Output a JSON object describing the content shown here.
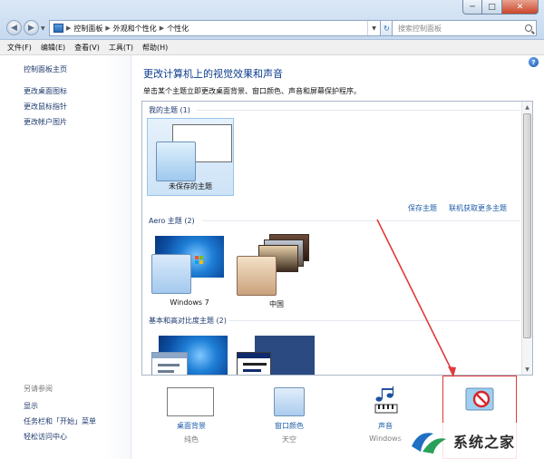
{
  "window": {
    "controls": {
      "minimize": "─",
      "maximize": "□",
      "close": "✕"
    }
  },
  "nav": {
    "back": "◀",
    "forward": "▶",
    "dropdown": "▼"
  },
  "address": {
    "crumbs": [
      "控制面板",
      "外观和个性化",
      "个性化"
    ],
    "separator": "▶",
    "dropdown": "▼"
  },
  "refresh": "↻",
  "search": {
    "placeholder": "搜索控制面板"
  },
  "menubar": [
    "文件(F)",
    "编辑(E)",
    "查看(V)",
    "工具(T)",
    "帮助(H)"
  ],
  "sidebar": {
    "home": "控制面板主页",
    "links": [
      "更改桌面图标",
      "更改鼠标指针",
      "更改帐户图片"
    ],
    "see_also": "另请参阅",
    "see_also_links": [
      "显示",
      "任务栏和「开始」菜单",
      "轻松访问中心"
    ]
  },
  "help": "?",
  "main": {
    "title": "更改计算机上的视觉效果和声音",
    "description": "单击某个主题立即更改桌面背景、窗口颜色、声音和屏幕保护程序。"
  },
  "themes": {
    "my_themes_header": "我的主题 (1)",
    "unsaved_theme": "未保存的主题",
    "save_theme": "保存主题",
    "get_more_online": "联机获取更多主题",
    "aero_header": "Aero 主题 (2)",
    "aero": [
      "Windows 7",
      "中国"
    ],
    "basic_header": "基本和高对比度主题 (2)"
  },
  "scrollbar": {
    "up": "▲",
    "down": "▼"
  },
  "customize": [
    {
      "label": "桌面背景",
      "value": "纯色"
    },
    {
      "label": "窗口颜色",
      "value": "天空"
    },
    {
      "label": "声音",
      "value": "Windows"
    }
  ],
  "watermark": {
    "text": "系统之家"
  },
  "colors": {
    "link": "#1e5ca8",
    "title": "#0b3c8c",
    "highlight": "#e03a3a"
  },
  "icons": {
    "back": "back-arrow-icon",
    "control_panel": "control-panel-icon",
    "search": "search-icon",
    "help": "help-icon",
    "screensaver": "no-screensaver-icon",
    "sound": "music-notes-icon"
  }
}
